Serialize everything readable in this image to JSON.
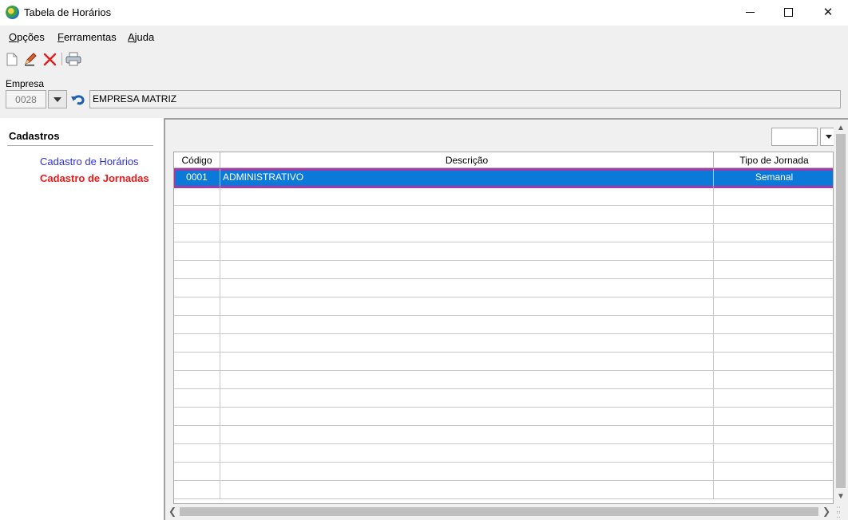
{
  "window": {
    "title": "Tabela de Horários",
    "minimize_icon": "minimize-icon",
    "maximize_icon": "maximize-icon",
    "close_icon": "close-icon",
    "close_glyph": "✕"
  },
  "menu": [
    {
      "label": "Opções",
      "accel": "O",
      "rest": "pções"
    },
    {
      "label": "Ferramentas",
      "accel": "F",
      "rest": "erramentas"
    },
    {
      "label": "Ajuda",
      "accel": "A",
      "rest": "juda"
    }
  ],
  "toolbar": {
    "icons": [
      "new-document-icon",
      "edit-pencil-icon",
      "delete-x-icon",
      "print-icon"
    ]
  },
  "empresa": {
    "label": "Empresa",
    "code": "0028",
    "name": "EMPRESA MATRIZ"
  },
  "sidebar": {
    "title": "Cadastros",
    "links": [
      {
        "label": "Cadastro de Horários",
        "color": "#2f2ee0"
      },
      {
        "label": "Cadastro de Jornadas",
        "color": "#f01818",
        "active": true
      }
    ]
  },
  "grid": {
    "columns": [
      "Código",
      "Descrição",
      "Tipo de Jornada"
    ],
    "rows": [
      {
        "codigo": "0001",
        "descricao": "ADMINISTRATIVO",
        "tipo": "Semanal",
        "selected": true
      }
    ],
    "empty_row_count": 17,
    "selection_color": "#0a79d7",
    "selection_outline": "#a33aa8"
  },
  "scroll": {
    "up_arrow": "▲",
    "down_arrow": "▼",
    "left_arrow": "❮",
    "right_arrow": "❯"
  }
}
